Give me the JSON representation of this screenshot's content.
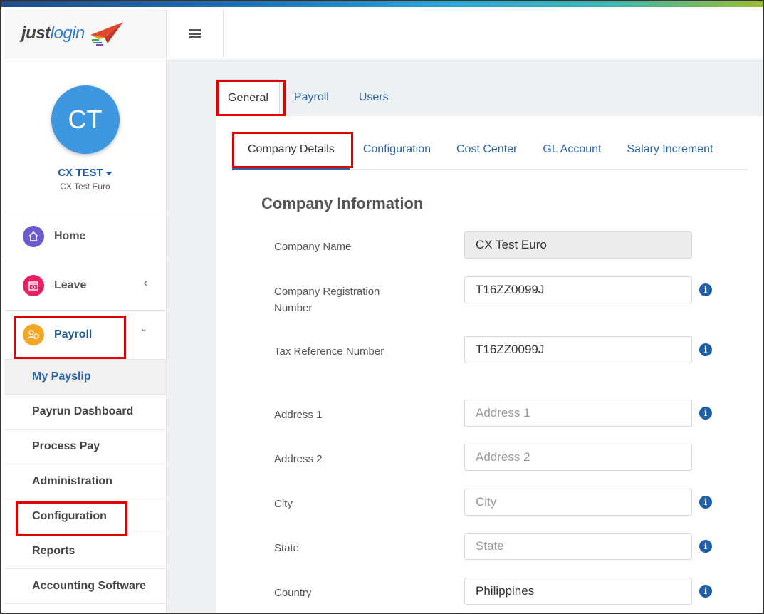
{
  "logo": {
    "just": "just",
    "login": "login"
  },
  "profile": {
    "initials": "CT",
    "name": "CX TEST",
    "company": "CX Test Euro"
  },
  "nav": {
    "home": "Home",
    "leave": "Leave",
    "payroll": "Payroll",
    "leave_chevron": "‹",
    "payroll_chevron": "⌄"
  },
  "payroll_menu": [
    "My Payslip",
    "Payrun Dashboard",
    "Process Pay",
    "Administration",
    "Configuration",
    "Reports",
    "Accounting Software"
  ],
  "top_tabs": [
    "General",
    "Payroll",
    "Users"
  ],
  "sub_tabs": [
    "Company Details",
    "Configuration",
    "Cost Center",
    "GL Account",
    "Salary Increment"
  ],
  "section_title": "Company Information",
  "form": {
    "company_name": {
      "label": "Company Name",
      "value": "CX Test Euro"
    },
    "registration": {
      "label": "Company Registration Number",
      "value": "T16ZZ0099J"
    },
    "tax_ref": {
      "label": "Tax Reference Number",
      "value": "T16ZZ0099J"
    },
    "address1": {
      "label": "Address 1",
      "placeholder": "Address 1"
    },
    "address2": {
      "label": "Address 2",
      "placeholder": "Address 2"
    },
    "city": {
      "label": "City",
      "placeholder": "City"
    },
    "state": {
      "label": "State",
      "placeholder": "State"
    },
    "country": {
      "label": "Country",
      "value": "Philippines"
    }
  },
  "info_glyph": "i"
}
